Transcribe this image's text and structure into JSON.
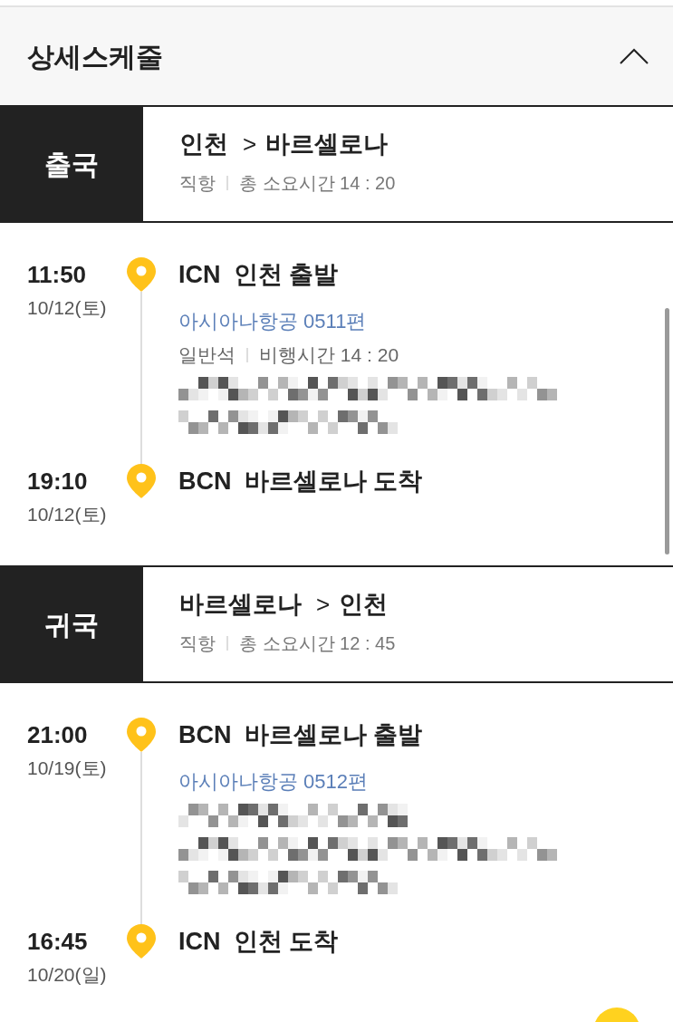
{
  "header": {
    "title": "상세스케줄",
    "expanded": true
  },
  "legs": [
    {
      "direction": "출국",
      "route": {
        "from": "인천",
        "separator": ">",
        "to": "바르셀로나"
      },
      "flight_type": "직항",
      "total_time": "총 소요시간 14 : 20",
      "departure": {
        "time": "11:50",
        "date": "10/12(토)",
        "code": "ICN",
        "place": "인천 출발"
      },
      "details": [
        {
          "kind": "airline",
          "text": "아시아나항공 0511편"
        },
        {
          "kind": "info",
          "parts": [
            "일반석",
            "비행시간 14 : 20"
          ]
        },
        {
          "kind": "pixelated"
        },
        {
          "kind": "pixelated"
        }
      ],
      "arrival": {
        "time": "19:10",
        "date": "10/12(토)",
        "code": "BCN",
        "place": "바르셀로나 도착"
      }
    },
    {
      "direction": "귀국",
      "route": {
        "from": "바르셀로나",
        "separator": ">",
        "to": "인천"
      },
      "flight_type": "직항",
      "total_time": "총 소요시간 12 : 45",
      "departure": {
        "time": "21:00",
        "date": "10/19(토)",
        "code": "BCN",
        "place": "바르셀로나 출발"
      },
      "details": [
        {
          "kind": "airline",
          "text": "아시아나항공 0512편"
        },
        {
          "kind": "pixelated"
        },
        {
          "kind": "pixelated"
        },
        {
          "kind": "pixelated"
        }
      ],
      "arrival": {
        "time": "16:45",
        "date": "10/20(일)",
        "code": "ICN",
        "place": "인천 도착"
      }
    }
  ]
}
